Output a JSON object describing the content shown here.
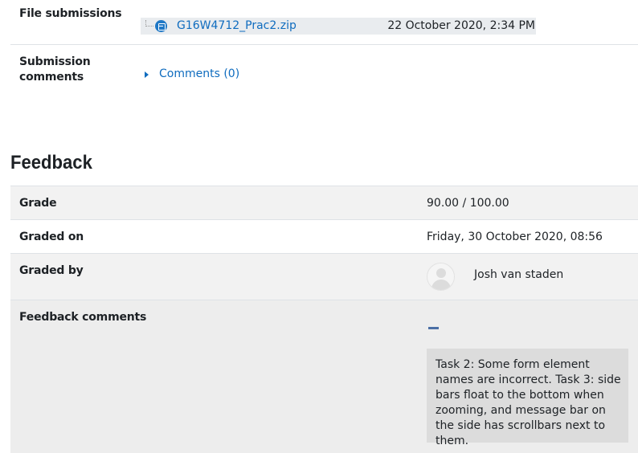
{
  "submission": {
    "files_label": "File submissions",
    "file": {
      "name": "G16W4712_Prac2.zip",
      "date": "22 October 2020, 2:34 PM",
      "icon": "archive-file-icon"
    },
    "comments_label": "Submission comments",
    "comments_link": "Comments (0)"
  },
  "feedback": {
    "title": "Feedback",
    "grade_label": "Grade",
    "grade_value": "90.00 / 100.00",
    "graded_on_label": "Graded on",
    "graded_on_value": "Friday, 30 October 2020, 08:56",
    "graded_by_label": "Graded by",
    "grader_name": "Josh van staden",
    "comments_label": "Feedback comments",
    "comments_text": "Task 2: Some form element names are incorrect. Task 3: side bars float to the bottom when zooming, and message bar on the side has scrollbars next to them."
  },
  "colors": {
    "link": "#0f6cbf",
    "row_shaded": "#f2f2f2",
    "comment_box": "#dcdcdc"
  }
}
